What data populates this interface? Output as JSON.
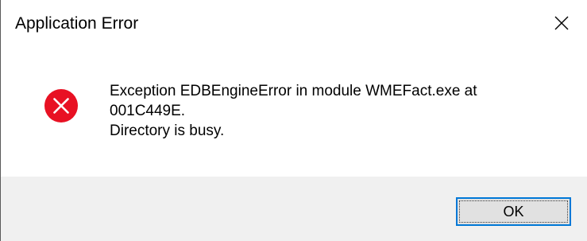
{
  "window": {
    "title": "Application Error"
  },
  "titlebar": {
    "close_icon": "close-icon"
  },
  "message": {
    "icon": "error-icon",
    "lines": [
      "Exception EDBEngineError in module WMEFact.exe at",
      "001C449E.",
      "Directory is busy."
    ]
  },
  "buttons": {
    "ok_label": "OK"
  },
  "colors": {
    "error_icon_fill": "#e81123",
    "button_focus_border": "#0078d7",
    "button_background": "#e1e1e1",
    "footer_background": "#f0f0f0"
  }
}
